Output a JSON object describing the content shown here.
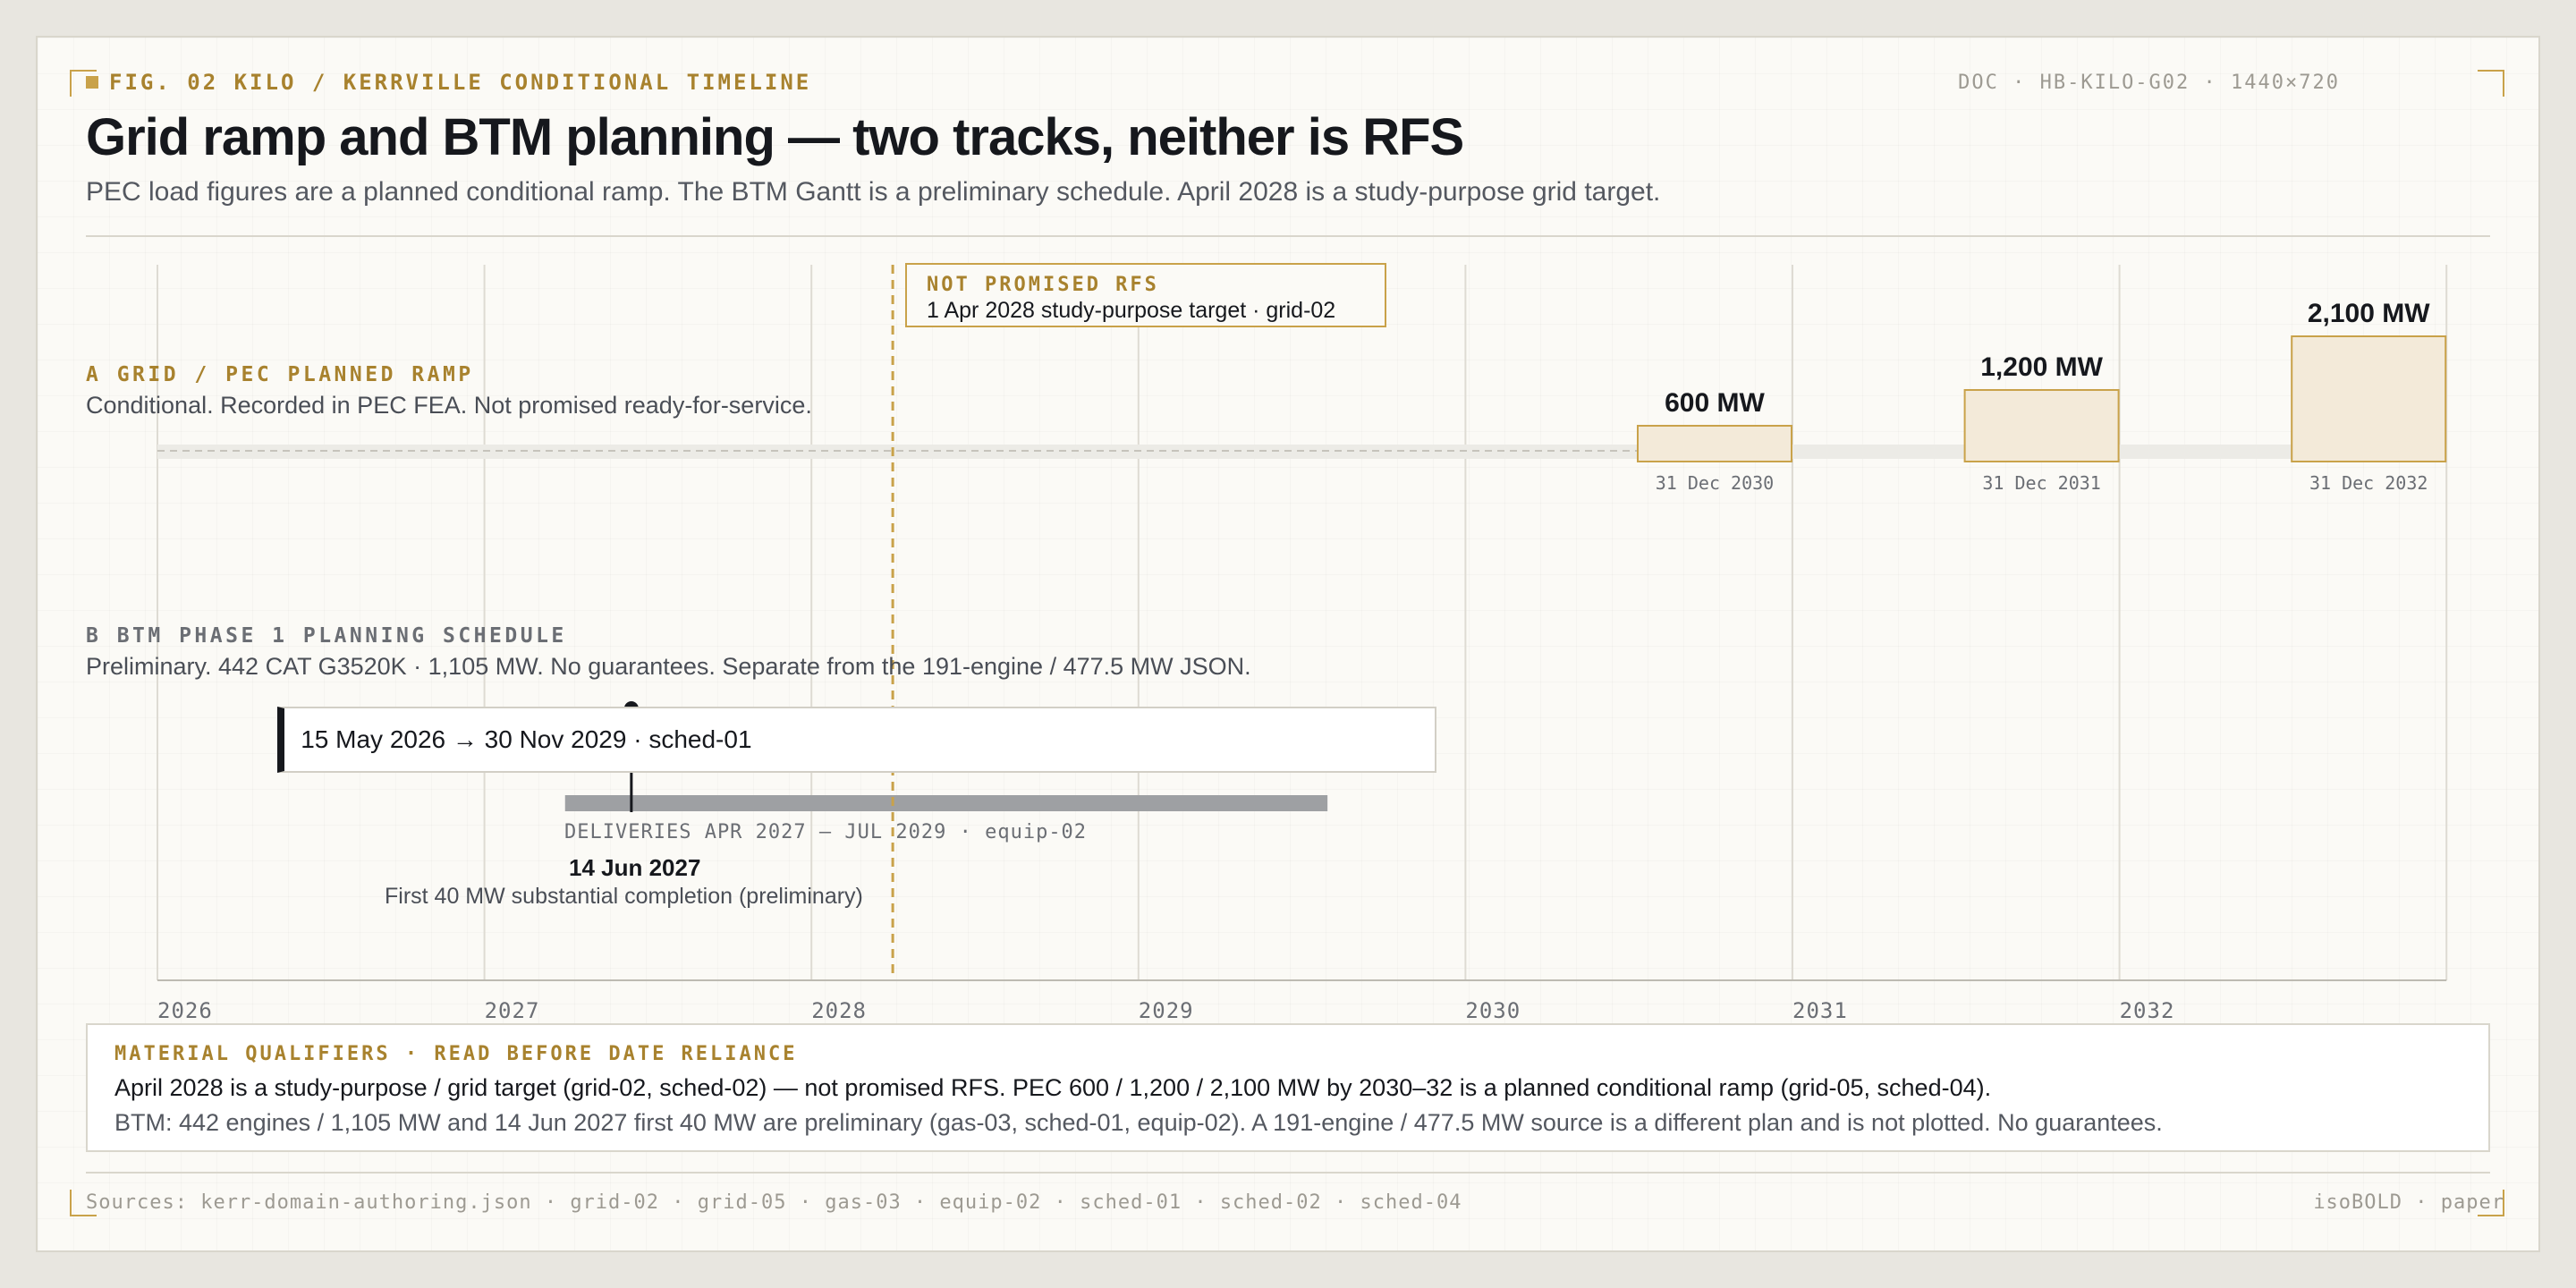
{
  "header": {
    "fig_label": "FIG. 02 KILO / KERRVILLE CONDITIONAL TIMELINE",
    "doc_label": "DOC · HB-KILO-G02 · 1440×720",
    "title": "Grid ramp and BTM planning — two tracks, neither is RFS",
    "subtitle": "PEC load figures are a planned conditional ramp. The BTM Gantt is a preliminary schedule. April 2028 is a study-purpose grid target."
  },
  "colors": {
    "accent": "#c9a24a",
    "accent_text": "#a8822e",
    "ink": "#16181d",
    "fill": "#f3ead9",
    "delivery_bar": "#9ea0a3"
  },
  "rfs_marker": {
    "kicker": "NOT PROMISED RFS",
    "text": "1 Apr 2028 study-purpose target · grid-02",
    "date": "2028-04-01"
  },
  "track_a": {
    "kicker": "A GRID / PEC PLANNED RAMP",
    "desc": "Conditional. Recorded in PEC FEA. Not promised ready-for-service."
  },
  "track_b": {
    "kicker": "B BTM PHASE 1 PLANNING SCHEDULE",
    "desc": "Preliminary. 442 CAT G3520K · 1,105 MW. No guarantees. Separate from the 191-engine / 477.5 MW JSON.",
    "schedule_label": "15 May 2026 → 30 Nov 2029 · sched-01",
    "deliveries_label": "DELIVERIES APR 2027 – JUL 2029 · equip-02",
    "milestone_date": "14 Jun 2027",
    "milestone_text": "First 40 MW substantial completion (preliminary)"
  },
  "chart_data": {
    "type": "timeline",
    "x_axis": {
      "ticks": [
        "2026",
        "2027",
        "2028",
        "2029",
        "2030",
        "2031",
        "2032"
      ],
      "range": [
        "2026-01-01",
        "2033-01-01"
      ]
    },
    "grid_ramp": [
      {
        "label": "600 MW",
        "mw": 600,
        "date_label": "31 Dec 2030",
        "date": "2030-12-31"
      },
      {
        "label": "1,200 MW",
        "mw": 1200,
        "date_label": "31 Dec 2031",
        "date": "2031-12-31"
      },
      {
        "label": "2,100 MW",
        "mw": 2100,
        "date_label": "31 Dec 2032",
        "date": "2032-12-31"
      }
    ],
    "btm_schedule": {
      "start": "2026-05-15",
      "end": "2029-11-30"
    },
    "deliveries": {
      "start": "2027-04-01",
      "end": "2029-07-31"
    },
    "milestone": {
      "date": "2027-06-14",
      "mw": 40
    },
    "rfs_target": "2028-04-01"
  },
  "qualifiers": {
    "kicker": "MATERIAL QUALIFIERS · READ BEFORE DATE RELIANCE",
    "line1": "April 2028 is a study-purpose / grid target (grid-02, sched-02) — not promised RFS. PEC 600 / 1,200 / 2,100 MW by 2030–32 is a planned conditional ramp (grid-05, sched-04).",
    "line2": "BTM: 442 engines / 1,105 MW and 14 Jun 2027 first 40 MW are preliminary (gas-03, sched-01, equip-02). A 191-engine / 477.5 MW source is a different plan and is not plotted. No guarantees."
  },
  "footer": {
    "sources": "Sources: kerr-domain-authoring.json · grid-02 · grid-05 · gas-03 · equip-02 · sched-01 · sched-02 · sched-04",
    "brand": "isoBOLD · paper"
  }
}
